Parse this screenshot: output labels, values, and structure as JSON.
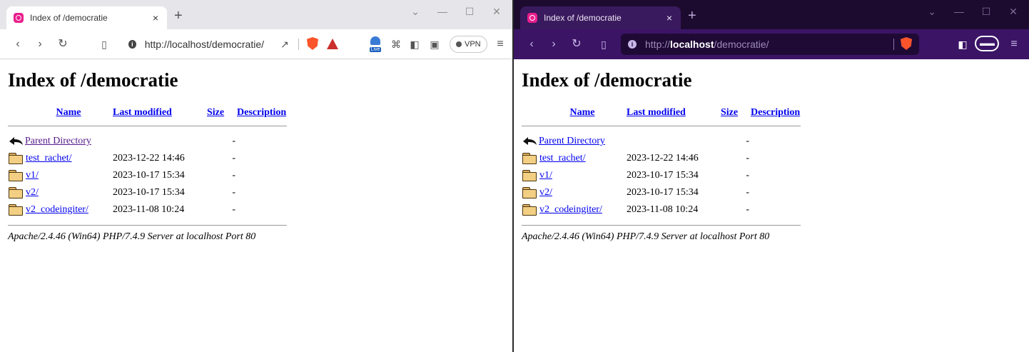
{
  "left_window": {
    "tab_title": "Index of /democratie",
    "tab_close": "×",
    "new_tab": "+",
    "win_controls": [
      "⌄",
      "—",
      "☐",
      "✕"
    ],
    "url": "http://localhost/democratie/",
    "vpn_label": "VPN",
    "live_label": "Live"
  },
  "right_window": {
    "tab_title": "Index of /democratie",
    "tab_close": "×",
    "new_tab": "+",
    "win_controls": [
      "⌄",
      "—",
      "☐",
      "✕"
    ],
    "url_prefix": "http://",
    "url_host": "localhost",
    "url_path": "/democratie/"
  },
  "page": {
    "heading": "Index of /democratie",
    "columns": {
      "name": "Name",
      "last_modified": "Last modified",
      "size": "Size",
      "description": "Description"
    },
    "parent": {
      "name": "Parent Directory",
      "size": "-"
    },
    "rows": [
      {
        "name": "test_rachet/",
        "modified": "2023-12-22 14:46",
        "size": "-"
      },
      {
        "name": "v1/",
        "modified": "2023-10-17 15:34",
        "size": "-"
      },
      {
        "name": "v2/",
        "modified": "2023-10-17 15:34",
        "size": "-"
      },
      {
        "name": "v2_codeingiter/",
        "modified": "2023-11-08 10:24",
        "size": "-"
      }
    ],
    "footer": "Apache/2.4.46 (Win64) PHP/7.4.9 Server at localhost Port 80"
  },
  "colors": {
    "link": "#0000ee",
    "visited": "#551a8b",
    "brave_dark_toolbar": "#3b1466",
    "brave_shield": "#fb542b"
  }
}
